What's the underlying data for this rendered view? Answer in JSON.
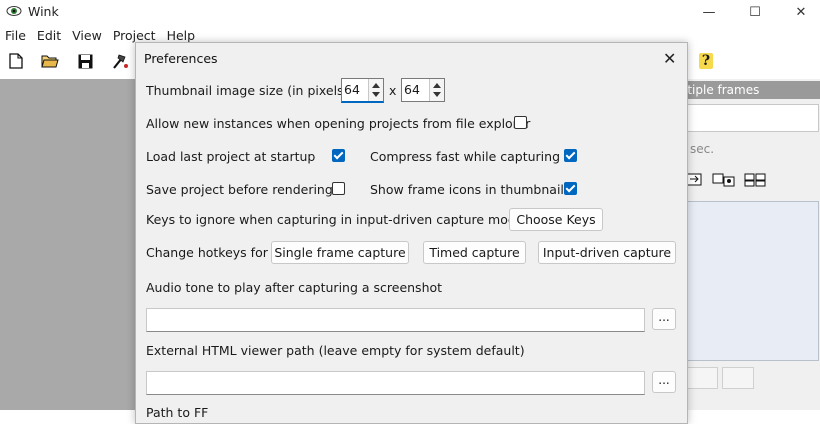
{
  "app": {
    "title": "Wink"
  },
  "window_controls": {
    "minimize": "—",
    "maximize": "☐",
    "close": "✕"
  },
  "menu": [
    "File",
    "Edit",
    "View",
    "Project",
    "Help"
  ],
  "toolbar": {
    "icons": [
      "new-file-icon",
      "open-folder-icon",
      "save-icon",
      "render-icon",
      "help-icon"
    ],
    "help_label": "?"
  },
  "right_panel": {
    "header": "ltiple frames",
    "sec_label": "sec."
  },
  "dialog": {
    "title": "Preferences",
    "close": "✕",
    "thumbnail_label": "Thumbnail image size (in pixels)",
    "thumb_width": "64",
    "thumb_x": "x",
    "thumb_height": "64",
    "allow_new_instances": {
      "label": "Allow new instances when opening projects from file explorer",
      "checked": false
    },
    "load_last_project": {
      "label": "Load last project at startup",
      "checked": true
    },
    "compress_fast": {
      "label": "Compress fast while capturing",
      "checked": true
    },
    "save_before_render": {
      "label": "Save project before rendering",
      "checked": false
    },
    "show_frame_icons": {
      "label": "Show frame icons in thumbnails",
      "checked": true
    },
    "keys_ignore_label": "Keys to ignore when capturing in input-driven capture mode",
    "choose_keys": "Choose Keys",
    "hotkeys_label": "Change hotkeys for",
    "single_frame": "Single frame capture",
    "timed_capture": "Timed capture",
    "input_driven": "Input-driven capture",
    "audio_label": "Audio tone to play after capturing a screenshot",
    "audio_path": "",
    "browse": "...",
    "html_viewer_label": "External HTML viewer path (leave empty for system default)",
    "html_viewer_path": "",
    "browse2": "...",
    "partial_label": "Path to FF"
  },
  "colors": {
    "accent": "#0067c0",
    "canvas": "#a9a9a9",
    "dialog_bg": "#f0f0f0"
  }
}
